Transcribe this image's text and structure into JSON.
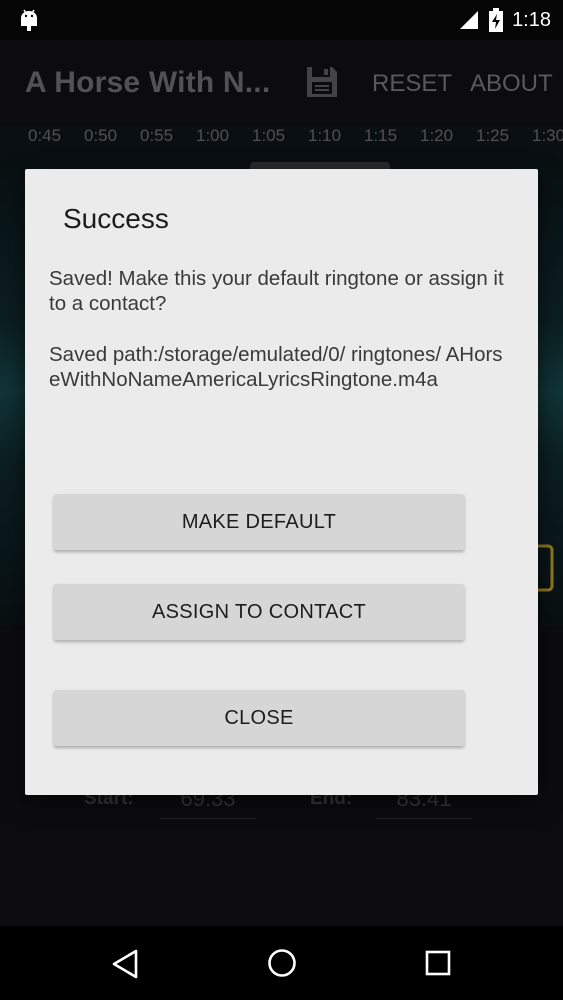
{
  "status_bar": {
    "time": "1:18",
    "icons": [
      "android-icon",
      "signal-icon",
      "battery-charging-icon"
    ]
  },
  "app_bar": {
    "title": "A Horse With N...",
    "save_icon": "save-icon",
    "reset_label": "RESET",
    "about_label": "ABOUT"
  },
  "timeline": {
    "ticks": [
      "0:45",
      "0:50",
      "0:55",
      "1:00",
      "1:05",
      "1:10",
      "1:15",
      "1:20",
      "1:25",
      "1:30"
    ]
  },
  "editor": {
    "start_label": "Start:",
    "start_value": "69.33",
    "end_label": "End:",
    "end_value": "83.41"
  },
  "dialog": {
    "title": "Success",
    "message": "Saved! Make this your default ringtone or assign it to a contact?",
    "path": "Saved path:/storage/emulated/0/ ringtones/ AHorseWithNoNameAmericaLyricsRingtone.m4a",
    "buttons": {
      "make_default": "MAKE DEFAULT",
      "assign_contact": "ASSIGN TO CONTACT",
      "close": "CLOSE"
    }
  },
  "nav_bar": {
    "icons": [
      "back-icon",
      "home-icon",
      "recent-apps-icon"
    ]
  },
  "colors": {
    "dialog_bg": "#ebebeb",
    "button_bg": "#d6d6d6",
    "app_bg": "#111015",
    "wave_teal": "#1f6f73"
  }
}
